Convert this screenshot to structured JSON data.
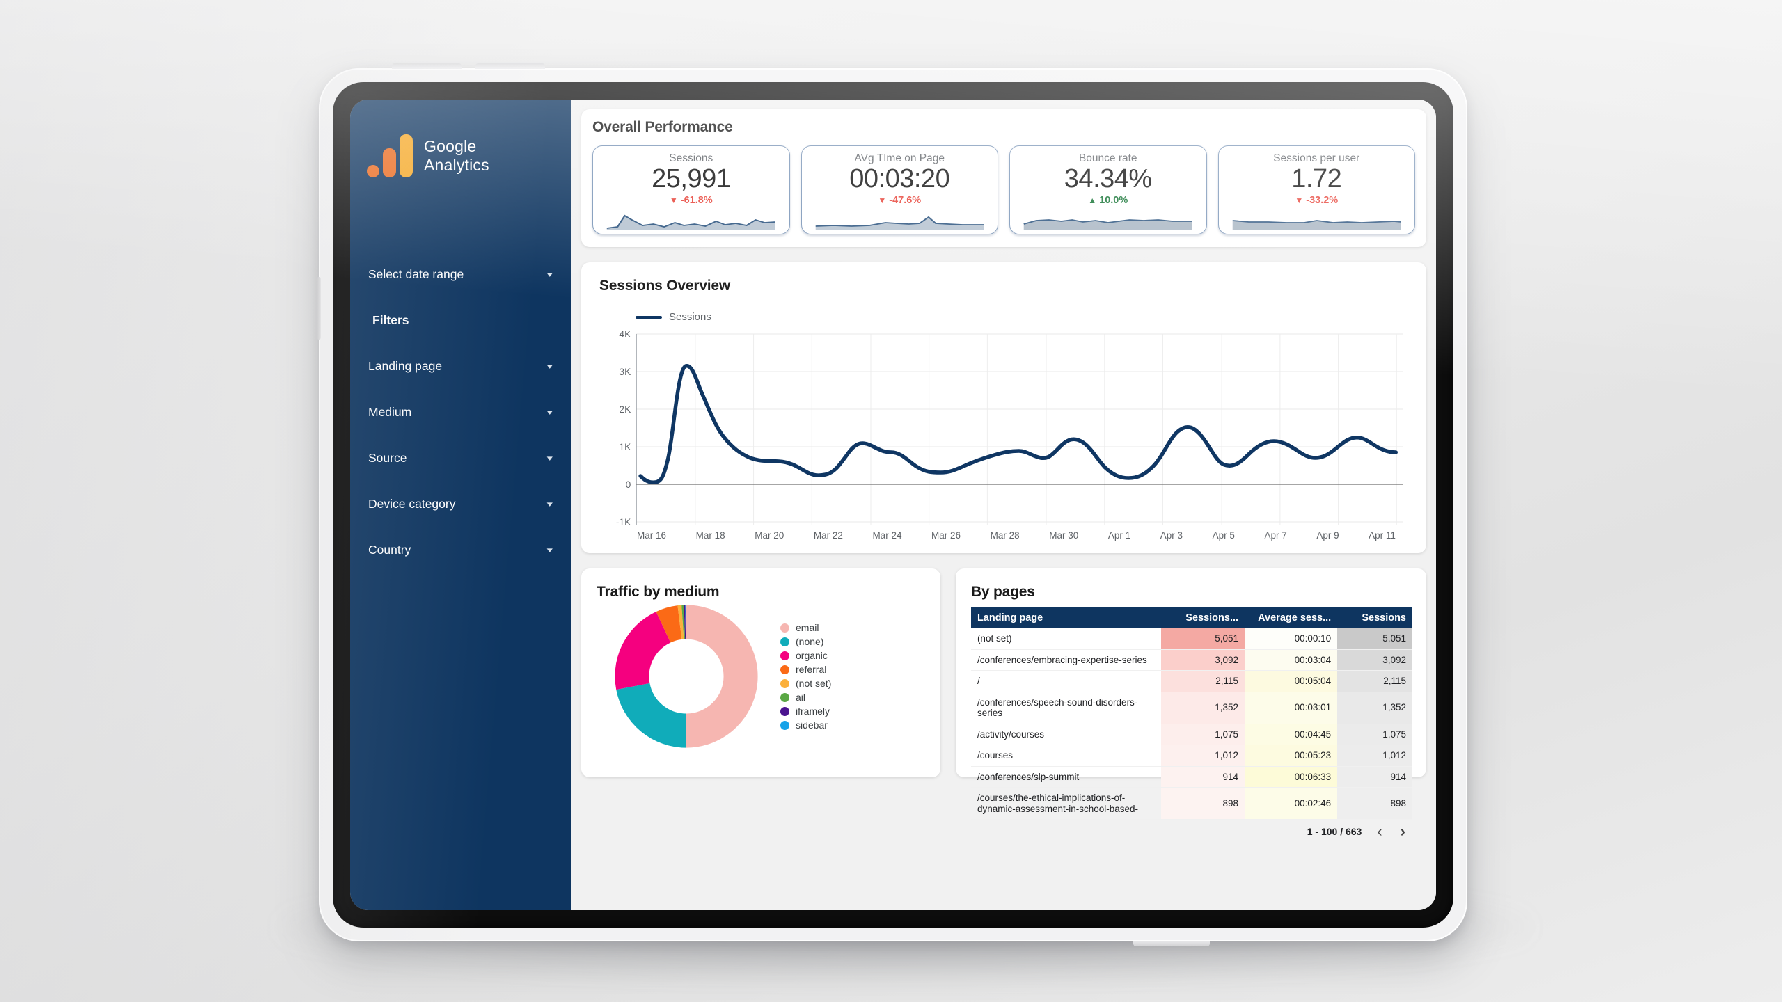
{
  "sidebar": {
    "brand": {
      "line1": "Google",
      "line2": "Analytics",
      "logo_icon": "google-analytics-logo"
    },
    "items": [
      {
        "label": "Select date range",
        "caret": "▾",
        "bold": false
      },
      {
        "label": "Filters",
        "caret": "",
        "bold": true
      },
      {
        "label": "Landing page",
        "caret": "▾",
        "bold": false
      },
      {
        "label": "Medium",
        "caret": "▾",
        "bold": false
      },
      {
        "label": "Source",
        "caret": "▾",
        "bold": false
      },
      {
        "label": "Device category",
        "caret": "▾",
        "bold": false
      },
      {
        "label": "Country",
        "caret": "▾",
        "bold": false
      }
    ],
    "bg_color": "#0e3560"
  },
  "overall": {
    "title": "Overall Performance",
    "cards": [
      {
        "label": "Sessions",
        "value": "25,991",
        "delta": "-61.8%",
        "direction": "down",
        "arrow": "↓"
      },
      {
        "label": "AVg TIme on Page",
        "value": "00:03:20",
        "delta": "-47.6%",
        "direction": "down",
        "arrow": "↓"
      },
      {
        "label": "Bounce rate",
        "value": "34.34%",
        "delta": "10.0%",
        "direction": "up",
        "arrow": "↑"
      },
      {
        "label": "Sessions per user",
        "value": "1.72",
        "delta": "-33.2%",
        "direction": "down",
        "arrow": "↓"
      }
    ],
    "down_color": "#e8443a",
    "up_color": "#137333"
  },
  "sessions_overview": {
    "title": "Sessions Overview",
    "legend": "Sessions"
  },
  "traffic_by_medium": {
    "title": "Traffic by medium"
  },
  "by_pages": {
    "title": "By pages",
    "columns": [
      "Landing page",
      "Sessions...",
      "Average sess...",
      "Sessions"
    ],
    "rows": [
      {
        "page": "(not set)",
        "sessions": "5,051",
        "avg": "00:00:10",
        "sessions2": "5,051"
      },
      {
        "page": "/conferences/embracing-expertise-series",
        "sessions": "3,092",
        "avg": "00:03:04",
        "sessions2": "3,092"
      },
      {
        "page": "/",
        "sessions": "2,115",
        "avg": "00:05:04",
        "sessions2": "2,115"
      },
      {
        "page": "/conferences/speech-sound-disorders-series",
        "sessions": "1,352",
        "avg": "00:03:01",
        "sessions2": "1,352"
      },
      {
        "page": "/activity/courses",
        "sessions": "1,075",
        "avg": "00:04:45",
        "sessions2": "1,075"
      },
      {
        "page": "/courses",
        "sessions": "1,012",
        "avg": "00:05:23",
        "sessions2": "1,012"
      },
      {
        "page": "/conferences/slp-summit",
        "sessions": "914",
        "avg": "00:06:33",
        "sessions2": "914"
      },
      {
        "page": "/courses/the-ethical-implications-of-dynamic-assessment-in-school-based-",
        "sessions": "898",
        "avg": "00:02:46",
        "sessions2": "898"
      }
    ],
    "footer": {
      "range": "1 - 100 / 663",
      "prev_icon": "‹",
      "next_icon": "›"
    }
  },
  "chart_data": [
    {
      "type": "line",
      "title": "Sessions Overview",
      "legend": [
        "Sessions"
      ],
      "legend_position": "top-left",
      "xlabel": "",
      "ylabel": "",
      "ylim": [
        -1000,
        4000
      ],
      "ytick_labels": [
        "4K",
        "3K",
        "2K",
        "1K",
        "0",
        "-1K"
      ],
      "ytick_values": [
        4000,
        3000,
        2000,
        1000,
        0,
        -1000
      ],
      "grid": true,
      "line_color": "#0f3663",
      "x": [
        "Mar 16",
        "Mar 17",
        "Mar 18",
        "Mar 19",
        "Mar 20",
        "Mar 21",
        "Mar 22",
        "Mar 23",
        "Mar 24",
        "Mar 25",
        "Mar 26",
        "Mar 27",
        "Mar 28",
        "Mar 29",
        "Mar 30",
        "Mar 31",
        "Apr 1",
        "Apr 2",
        "Apr 3",
        "Apr 4",
        "Apr 5",
        "Apr 6",
        "Apr 7",
        "Apr 8",
        "Apr 9",
        "Apr 10",
        "Apr 11",
        "Apr 12"
      ],
      "tick_labels": [
        "Mar 16",
        "Mar 18",
        "Mar 20",
        "Mar 22",
        "Mar 24",
        "Mar 26",
        "Mar 28",
        "Mar 30",
        "Apr 1",
        "Apr 3",
        "Apr 5",
        "Apr 7",
        "Apr 9",
        "Apr 11"
      ],
      "series": [
        {
          "name": "Sessions",
          "values": [
            220,
            60,
            3150,
            2550,
            1900,
            1450,
            1050,
            780,
            700,
            620,
            420,
            300,
            900,
            1150,
            800,
            1120,
            620,
            330,
            500,
            750,
            900,
            700,
            1050,
            460,
            240,
            700,
            1380,
            1250
          ]
        }
      ]
    },
    {
      "type": "pie",
      "title": "Traffic by medium",
      "donut": true,
      "labels": [
        "email",
        "(none)",
        "organic",
        "referral",
        "(not set)",
        "ail",
        "iframely",
        "sidebar"
      ],
      "values": [
        50.0,
        22.0,
        21.0,
        5.0,
        0.9,
        0.5,
        0.3,
        0.3
      ],
      "colors": [
        "#f6b6b1",
        "#10acba",
        "#f5007f",
        "#fb6a16",
        "#fbb03b",
        "#5aa744",
        "#4b148f",
        "#17a2e8"
      ],
      "legend_position": "right"
    }
  ],
  "sparklines": {
    "line_color": "#2d5580",
    "fill_color": "#b7c4d1"
  }
}
